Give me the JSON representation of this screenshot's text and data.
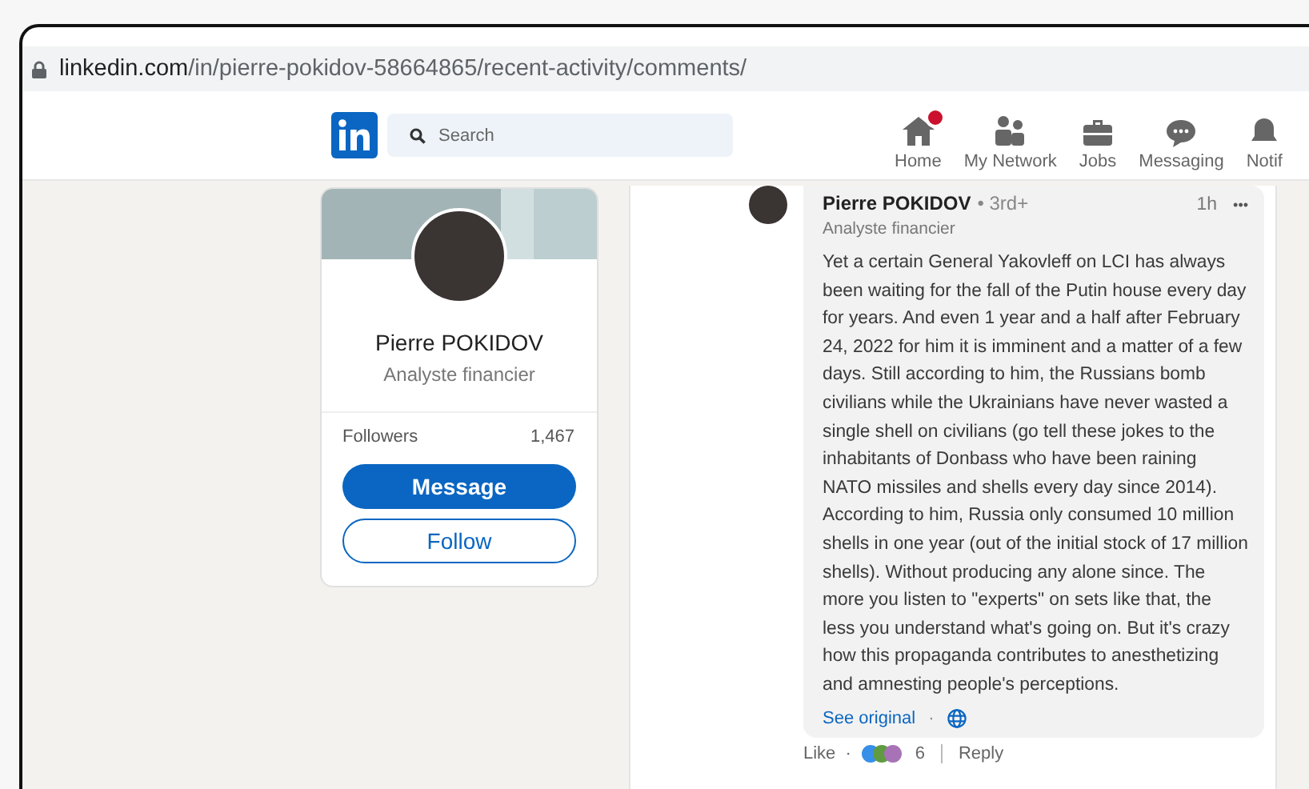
{
  "address_bar": {
    "domain": "linkedin.com",
    "path": "/in/pierre-pokidov-58664865/recent-activity/comments/"
  },
  "nav": {
    "search": {
      "placeholder": "Search"
    },
    "items": [
      {
        "label": "Home",
        "kind": "home",
        "badge": true
      },
      {
        "label": "My Network",
        "kind": "network",
        "badge": false
      },
      {
        "label": "Jobs",
        "kind": "jobs",
        "badge": false
      },
      {
        "label": "Messaging",
        "kind": "messaging",
        "badge": false
      },
      {
        "label": "Notif",
        "kind": "bell",
        "badge": false
      }
    ]
  },
  "profile_card": {
    "name": "Pierre POKIDOV",
    "headline": "Analyste financier",
    "followers_label": "Followers",
    "followers_count": "1,467",
    "buttons": [
      {
        "label": "Message",
        "kind": "primary"
      },
      {
        "label": "Follow",
        "kind": "secondary"
      }
    ]
  },
  "comment": {
    "author": "Pierre POKIDOV",
    "degree": "• 3rd+",
    "headline": "Analyste financier",
    "time": "1h",
    "more": "•••",
    "text": "Yet a certain General Yakovleff on LCI has always been waiting for the fall of the Putin house every day for years. And even 1 year and a half after February 24, 2022 for him it is imminent and a matter of a few days. Still according to him, the Russians bomb civilians while the Ukrainians have never wasted a single shell on civilians (go tell these jokes to the inhabitants of Donbass who have been raining NATO missiles and shells every day since 2014). According to him, Russia only consumed 10 million shells in one year (out of the initial stock of 17 million shells). Without producing any alone since. The more you listen to \"experts\" on sets like that, the less you understand what's going on. But it's crazy how this propaganda contributes to anesthetizing and amnesting people's perceptions.",
    "see_original": "See original",
    "separator": "·",
    "actions": {
      "like": "Like",
      "separator": "·",
      "reaction_count": "6",
      "reply": "Reply"
    }
  }
}
